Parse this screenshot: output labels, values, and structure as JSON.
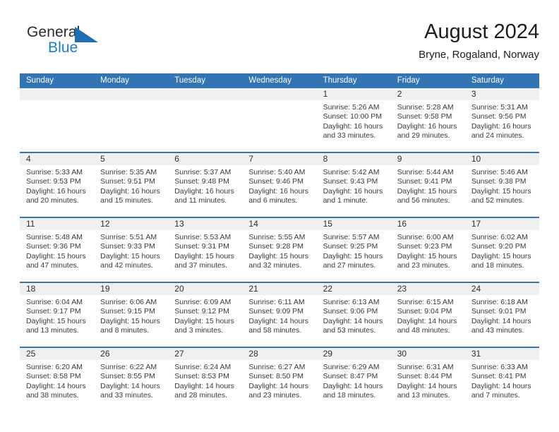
{
  "brand": {
    "name_part1": "General",
    "name_part2": "Blue",
    "triangle_color": "#1f6fb3",
    "blue_color": "#1a7fc1"
  },
  "header": {
    "title": "August 2024",
    "subtitle": "Bryne, Rogaland, Norway"
  },
  "theme": {
    "header_blue": "#3274b4",
    "date_strip_gray": "#f0f0f0",
    "text_color": "#3a3a3a"
  },
  "weekdays": [
    "Sunday",
    "Monday",
    "Tuesday",
    "Wednesday",
    "Thursday",
    "Friday",
    "Saturday"
  ],
  "weeks": [
    [
      {
        "day": "",
        "sunrise": "",
        "sunset": "",
        "daylight1": "",
        "daylight2": ""
      },
      {
        "day": "",
        "sunrise": "",
        "sunset": "",
        "daylight1": "",
        "daylight2": ""
      },
      {
        "day": "",
        "sunrise": "",
        "sunset": "",
        "daylight1": "",
        "daylight2": ""
      },
      {
        "day": "",
        "sunrise": "",
        "sunset": "",
        "daylight1": "",
        "daylight2": ""
      },
      {
        "day": "1",
        "sunrise": "Sunrise: 5:26 AM",
        "sunset": "Sunset: 10:00 PM",
        "daylight1": "Daylight: 16 hours",
        "daylight2": "and 33 minutes."
      },
      {
        "day": "2",
        "sunrise": "Sunrise: 5:28 AM",
        "sunset": "Sunset: 9:58 PM",
        "daylight1": "Daylight: 16 hours",
        "daylight2": "and 29 minutes."
      },
      {
        "day": "3",
        "sunrise": "Sunrise: 5:31 AM",
        "sunset": "Sunset: 9:56 PM",
        "daylight1": "Daylight: 16 hours",
        "daylight2": "and 24 minutes."
      }
    ],
    [
      {
        "day": "4",
        "sunrise": "Sunrise: 5:33 AM",
        "sunset": "Sunset: 9:53 PM",
        "daylight1": "Daylight: 16 hours",
        "daylight2": "and 20 minutes."
      },
      {
        "day": "5",
        "sunrise": "Sunrise: 5:35 AM",
        "sunset": "Sunset: 9:51 PM",
        "daylight1": "Daylight: 16 hours",
        "daylight2": "and 15 minutes."
      },
      {
        "day": "6",
        "sunrise": "Sunrise: 5:37 AM",
        "sunset": "Sunset: 9:48 PM",
        "daylight1": "Daylight: 16 hours",
        "daylight2": "and 11 minutes."
      },
      {
        "day": "7",
        "sunrise": "Sunrise: 5:40 AM",
        "sunset": "Sunset: 9:46 PM",
        "daylight1": "Daylight: 16 hours",
        "daylight2": "and 6 minutes."
      },
      {
        "day": "8",
        "sunrise": "Sunrise: 5:42 AM",
        "sunset": "Sunset: 9:43 PM",
        "daylight1": "Daylight: 16 hours",
        "daylight2": "and 1 minute."
      },
      {
        "day": "9",
        "sunrise": "Sunrise: 5:44 AM",
        "sunset": "Sunset: 9:41 PM",
        "daylight1": "Daylight: 15 hours",
        "daylight2": "and 56 minutes."
      },
      {
        "day": "10",
        "sunrise": "Sunrise: 5:46 AM",
        "sunset": "Sunset: 9:38 PM",
        "daylight1": "Daylight: 15 hours",
        "daylight2": "and 52 minutes."
      }
    ],
    [
      {
        "day": "11",
        "sunrise": "Sunrise: 5:48 AM",
        "sunset": "Sunset: 9:36 PM",
        "daylight1": "Daylight: 15 hours",
        "daylight2": "and 47 minutes."
      },
      {
        "day": "12",
        "sunrise": "Sunrise: 5:51 AM",
        "sunset": "Sunset: 9:33 PM",
        "daylight1": "Daylight: 15 hours",
        "daylight2": "and 42 minutes."
      },
      {
        "day": "13",
        "sunrise": "Sunrise: 5:53 AM",
        "sunset": "Sunset: 9:31 PM",
        "daylight1": "Daylight: 15 hours",
        "daylight2": "and 37 minutes."
      },
      {
        "day": "14",
        "sunrise": "Sunrise: 5:55 AM",
        "sunset": "Sunset: 9:28 PM",
        "daylight1": "Daylight: 15 hours",
        "daylight2": "and 32 minutes."
      },
      {
        "day": "15",
        "sunrise": "Sunrise: 5:57 AM",
        "sunset": "Sunset: 9:25 PM",
        "daylight1": "Daylight: 15 hours",
        "daylight2": "and 27 minutes."
      },
      {
        "day": "16",
        "sunrise": "Sunrise: 6:00 AM",
        "sunset": "Sunset: 9:23 PM",
        "daylight1": "Daylight: 15 hours",
        "daylight2": "and 23 minutes."
      },
      {
        "day": "17",
        "sunrise": "Sunrise: 6:02 AM",
        "sunset": "Sunset: 9:20 PM",
        "daylight1": "Daylight: 15 hours",
        "daylight2": "and 18 minutes."
      }
    ],
    [
      {
        "day": "18",
        "sunrise": "Sunrise: 6:04 AM",
        "sunset": "Sunset: 9:17 PM",
        "daylight1": "Daylight: 15 hours",
        "daylight2": "and 13 minutes."
      },
      {
        "day": "19",
        "sunrise": "Sunrise: 6:06 AM",
        "sunset": "Sunset: 9:15 PM",
        "daylight1": "Daylight: 15 hours",
        "daylight2": "and 8 minutes."
      },
      {
        "day": "20",
        "sunrise": "Sunrise: 6:09 AM",
        "sunset": "Sunset: 9:12 PM",
        "daylight1": "Daylight: 15 hours",
        "daylight2": "and 3 minutes."
      },
      {
        "day": "21",
        "sunrise": "Sunrise: 6:11 AM",
        "sunset": "Sunset: 9:09 PM",
        "daylight1": "Daylight: 14 hours",
        "daylight2": "and 58 minutes."
      },
      {
        "day": "22",
        "sunrise": "Sunrise: 6:13 AM",
        "sunset": "Sunset: 9:06 PM",
        "daylight1": "Daylight: 14 hours",
        "daylight2": "and 53 minutes."
      },
      {
        "day": "23",
        "sunrise": "Sunrise: 6:15 AM",
        "sunset": "Sunset: 9:04 PM",
        "daylight1": "Daylight: 14 hours",
        "daylight2": "and 48 minutes."
      },
      {
        "day": "24",
        "sunrise": "Sunrise: 6:18 AM",
        "sunset": "Sunset: 9:01 PM",
        "daylight1": "Daylight: 14 hours",
        "daylight2": "and 43 minutes."
      }
    ],
    [
      {
        "day": "25",
        "sunrise": "Sunrise: 6:20 AM",
        "sunset": "Sunset: 8:58 PM",
        "daylight1": "Daylight: 14 hours",
        "daylight2": "and 38 minutes."
      },
      {
        "day": "26",
        "sunrise": "Sunrise: 6:22 AM",
        "sunset": "Sunset: 8:55 PM",
        "daylight1": "Daylight: 14 hours",
        "daylight2": "and 33 minutes."
      },
      {
        "day": "27",
        "sunrise": "Sunrise: 6:24 AM",
        "sunset": "Sunset: 8:53 PM",
        "daylight1": "Daylight: 14 hours",
        "daylight2": "and 28 minutes."
      },
      {
        "day": "28",
        "sunrise": "Sunrise: 6:27 AM",
        "sunset": "Sunset: 8:50 PM",
        "daylight1": "Daylight: 14 hours",
        "daylight2": "and 23 minutes."
      },
      {
        "day": "29",
        "sunrise": "Sunrise: 6:29 AM",
        "sunset": "Sunset: 8:47 PM",
        "daylight1": "Daylight: 14 hours",
        "daylight2": "and 18 minutes."
      },
      {
        "day": "30",
        "sunrise": "Sunrise: 6:31 AM",
        "sunset": "Sunset: 8:44 PM",
        "daylight1": "Daylight: 14 hours",
        "daylight2": "and 13 minutes."
      },
      {
        "day": "31",
        "sunrise": "Sunrise: 6:33 AM",
        "sunset": "Sunset: 8:41 PM",
        "daylight1": "Daylight: 14 hours",
        "daylight2": "and 7 minutes."
      }
    ]
  ]
}
